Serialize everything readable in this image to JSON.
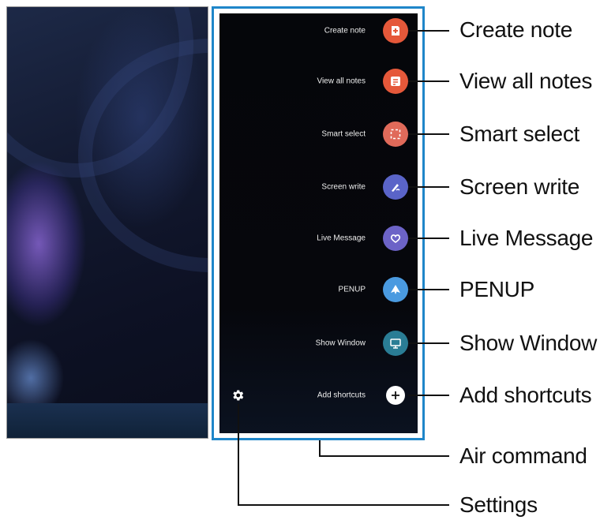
{
  "menu": {
    "items": [
      {
        "label": "Create note",
        "callout": "Create note",
        "color": "#e5583a"
      },
      {
        "label": "View all notes",
        "callout": "View all notes",
        "color": "#e5583a"
      },
      {
        "label": "Smart select",
        "callout": "Smart select",
        "color": "#e06a5a"
      },
      {
        "label": "Screen write",
        "callout": "Screen write",
        "color": "#5a64c8"
      },
      {
        "label": "Live Message",
        "callout": "Live Message",
        "color": "#6c63c7"
      },
      {
        "label": "PENUP",
        "callout": "PENUP",
        "color": "#4a9ae0"
      },
      {
        "label": "Show Window",
        "callout": "Show Window",
        "color": "#2a7d95"
      },
      {
        "label": "Add shortcuts",
        "callout": "Add shortcuts",
        "color": "#ffffff"
      }
    ],
    "panel_callout": "Air command",
    "settings_callout": "Settings"
  },
  "colors": {
    "frame": "#1f86c9",
    "panel_background": "#05060a"
  }
}
